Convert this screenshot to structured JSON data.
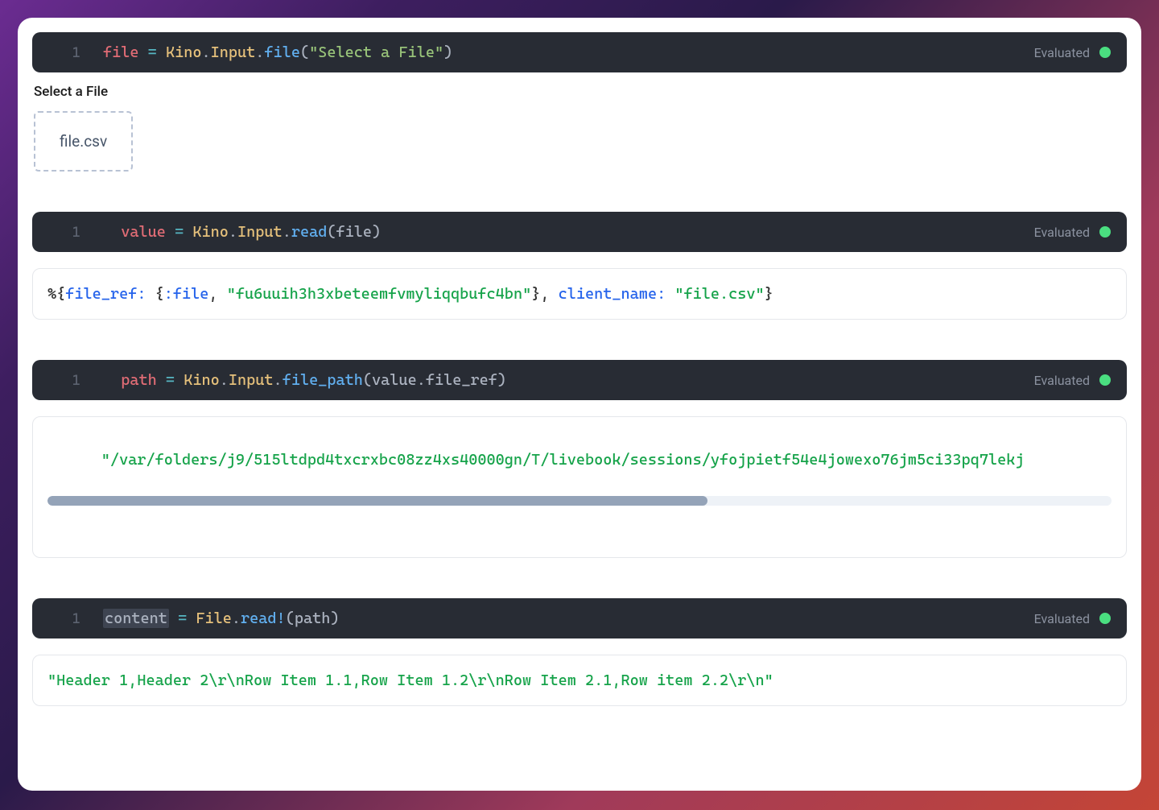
{
  "status": {
    "evaluated": "Evaluated"
  },
  "cells": [
    {
      "line": "1",
      "code": {
        "var": "file",
        "assign": " = ",
        "mod1": "Kino",
        "dot1": ".",
        "mod2": "Input",
        "dot2": ".",
        "fn": "file",
        "lparen": "(",
        "str": "\"Select a File\"",
        "rparen": ")"
      },
      "input": {
        "label": "Select a File",
        "filename": "file.csv"
      }
    },
    {
      "line": "1",
      "code": {
        "indent": "  ",
        "var": "value",
        "assign": " = ",
        "mod1": "Kino",
        "dot1": ".",
        "mod2": "Input",
        "dot2": ".",
        "fn": "read",
        "lparen": "(",
        "arg": "file",
        "rparen": ")"
      },
      "output": {
        "p1": "%{",
        "k1": "file_ref:",
        "sp1": " ",
        "p2": "{",
        "a1": ":file",
        "c1": ", ",
        "s1": "\"fu6uuih3h3xbeteemfvmyliqqbufc4bn\"",
        "p3": "}",
        "c2": ", ",
        "k2": "client_name:",
        "sp2": " ",
        "s2": "\"file.csv\"",
        "p4": "}"
      }
    },
    {
      "line": "1",
      "code": {
        "indent": "  ",
        "var": "path",
        "assign": " = ",
        "mod1": "Kino",
        "dot1": ".",
        "mod2": "Input",
        "dot2": ".",
        "fn": "file_path",
        "lparen": "(",
        "arg1": "value",
        "dot3": ".",
        "arg2": "file_ref",
        "rparen": ")"
      },
      "output_str": "\"/var/folders/j9/515ltdpd4txcrxbc08zz4xs40000gn/T/livebook/sessions/yfojpietf54e4jowexo76jm5ci33pq7lekj"
    },
    {
      "line": "1",
      "code": {
        "var_hl": "content",
        "assign": " = ",
        "mod1": "File",
        "dot1": ".",
        "fn": "read!",
        "lparen": "(",
        "arg": "path",
        "rparen": ")"
      },
      "output_str": "\"Header 1,Header 2\\r\\nRow Item 1.1,Row Item 1.2\\r\\nRow Item 2.1,Row item 2.2\\r\\n\""
    }
  ]
}
